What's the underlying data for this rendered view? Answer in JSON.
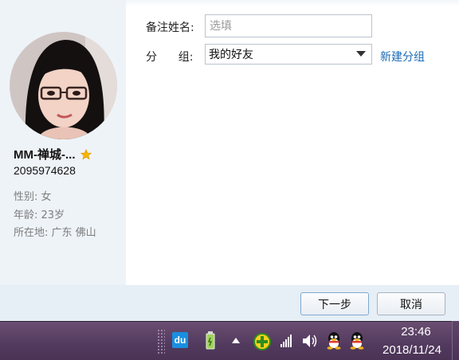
{
  "profile": {
    "nickname": "MM-禅城-...",
    "qq_number": "2095974628",
    "gender_line": "性别: 女",
    "age_line": "年龄: 23岁",
    "location_line": "所在地: 广东  佛山"
  },
  "form": {
    "remark_label": "备注姓名:",
    "remark_placeholder": "选填",
    "remark_value": "",
    "group_label": "分      组:",
    "group_selected": "我的好友",
    "new_group_link": "新建分组"
  },
  "buttons": {
    "next": "下一步",
    "cancel": "取消"
  },
  "taskbar": {
    "du_icon_text": "du",
    "time": "23:46",
    "date": "2018/11/24"
  },
  "colors": {
    "link": "#1b6bb7",
    "star": "#f5b400",
    "taskbar": "#523a5e"
  },
  "icons": [
    "avatar",
    "star-icon",
    "dropdown-arrow-icon",
    "baidu-du-icon",
    "usb-battery-icon",
    "show-hidden-icons-arrow",
    "green-plus-security-icon",
    "network-signal-icon",
    "volume-icon",
    "qq-penguin-icon"
  ]
}
